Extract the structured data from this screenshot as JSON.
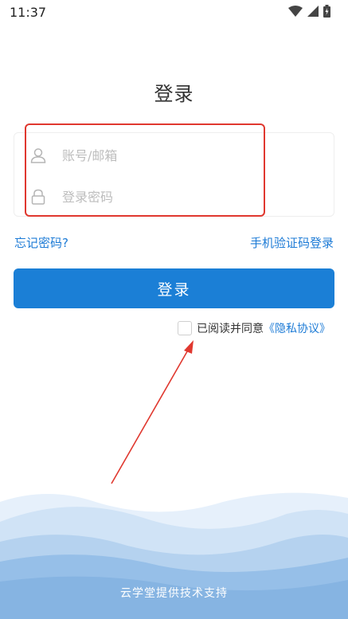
{
  "status_bar": {
    "time": "11:37"
  },
  "title": "登录",
  "form": {
    "account_placeholder": "账号/邮箱",
    "password_placeholder": "登录密码"
  },
  "links": {
    "forgot_password": "忘记密码?",
    "sms_login": "手机验证码登录"
  },
  "login_button": "登录",
  "agreement": {
    "prefix": "已阅读并同意",
    "privacy_link": "《隐私协议》",
    "checked": false
  },
  "footer": "云学堂提供技术支持",
  "colors": {
    "accent": "#1b7fd6",
    "link": "#1d7bd6",
    "annotation": "#e0382f"
  },
  "icons": [
    "wifi-icon",
    "cellular-icon",
    "battery-icon",
    "user-icon",
    "lock-icon"
  ]
}
